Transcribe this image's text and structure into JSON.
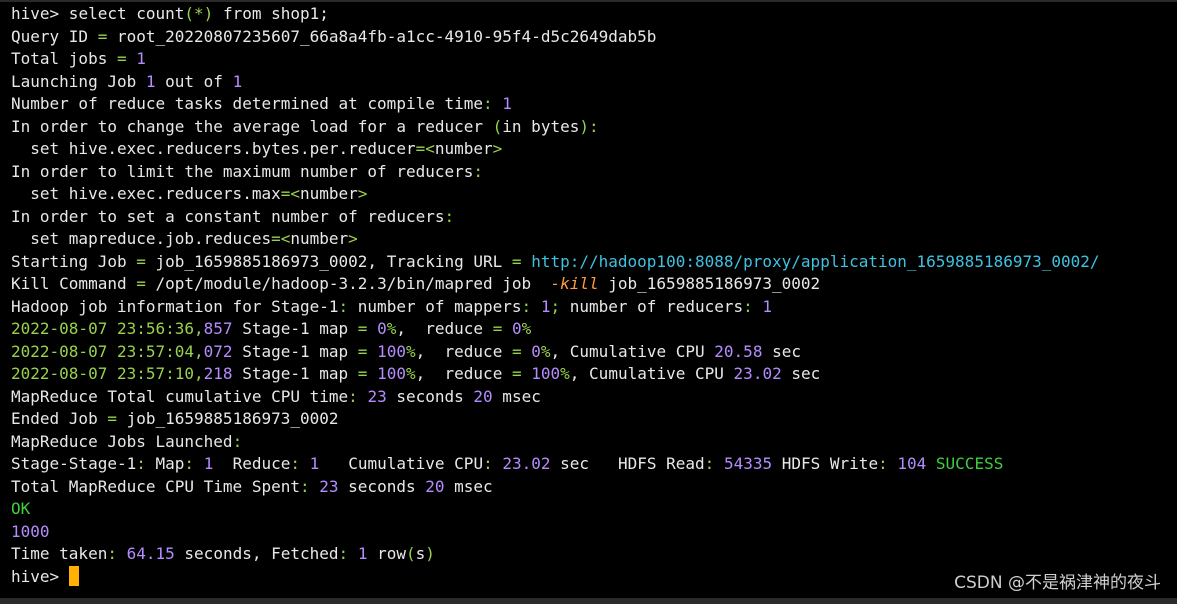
{
  "lines": {
    "l1_prompt": "hive>",
    "l1_cmd_a": " select count",
    "l1_cmd_b": "(*)",
    "l1_cmd_c": " from shop1;",
    "l2_a": "Query ID ",
    "l2_b": "=",
    "l2_c": " root_20220807235607_66a8a4fb-a1cc-4910-95f4-d5c2649dab5b",
    "l3_a": "Total jobs ",
    "l3_b": "=",
    "l3_c": "1",
    "l4_a": "Launching Job ",
    "l4_b": "1",
    "l4_c": " out of ",
    "l4_d": "1",
    "l5_a": "Number of reduce tasks determined at compile time",
    "l5_b": ":",
    "l5_c": "1",
    "l6_a": "In order to change the average load for a reducer ",
    "l6_b": "(",
    "l6_c": "in bytes",
    "l6_d": "):",
    "l7_a": "  set hive.exec.reducers.bytes.per.reducer",
    "l7_b": "=<",
    "l7_c": "number",
    "l7_d": ">",
    "l8_a": "In order to limit the maximum number of reducers",
    "l8_b": ":",
    "l9_a": "  set hive.exec.reducers.max",
    "l9_b": "=<",
    "l9_c": "number",
    "l9_d": ">",
    "l10_a": "In order to set a constant number of reducers",
    "l10_b": ":",
    "l11_a": "  set mapreduce.job.reduces",
    "l11_b": "=<",
    "l11_c": "number",
    "l11_d": ">",
    "l12_a": "Starting Job ",
    "l12_b": "=",
    "l12_c": " job_1659885186973_0002, Tracking URL ",
    "l12_d": "=",
    "l12_e": "http://hadoop100:8088/proxy/application_1659885186973_0002/",
    "l13_a": "Kill Command ",
    "l13_b": "=",
    "l13_c": " /opt/module/hadoop-3.2.3/bin/mapred job  ",
    "l13_d": "-kill",
    "l13_e": " job_1659885186973_0002",
    "l14_a": "Hadoop job information for Stage-1",
    "l14_b": ":",
    "l14_c": " number of mappers",
    "l14_d": ":",
    "l14_e": "1",
    "l14_f": ";",
    "l14_g": " number of reducers",
    "l14_h": ":",
    "l14_i": "1",
    "l15_date": "2022-08-07 23:56:36,",
    "l15_ms": "857",
    "l15_a": " Stage-1 map ",
    "l15_b": "=",
    "l15_c": "0",
    "l15_d": "%",
    "l15_e": ",  reduce ",
    "l15_f": "=",
    "l15_g": "0",
    "l15_h": "%",
    "l16_date": "2022-08-07 23:57:04,",
    "l16_ms": "072",
    "l16_a": " Stage-1 map ",
    "l16_b": "=",
    "l16_c": "100",
    "l16_d": "%",
    "l16_e": ",  reduce ",
    "l16_f": "=",
    "l16_g": "0",
    "l16_h": "%",
    "l16_i": ", Cumulative CPU ",
    "l16_j": "20.58",
    "l16_k": " sec",
    "l17_date": "2022-08-07 23:57:10,",
    "l17_ms": "218",
    "l17_a": " Stage-1 map ",
    "l17_b": "=",
    "l17_c": "100",
    "l17_d": "%",
    "l17_e": ",  reduce ",
    "l17_f": "=",
    "l17_g": "100",
    "l17_h": "%",
    "l17_i": ", Cumulative CPU ",
    "l17_j": "23.02",
    "l17_k": " sec",
    "l18_a": "MapReduce Total cumulative CPU time",
    "l18_b": ":",
    "l18_c": "23",
    "l18_d": " seconds ",
    "l18_e": "20",
    "l18_f": " msec",
    "l19_a": "Ended Job ",
    "l19_b": "=",
    "l19_c": " job_1659885186973_0002",
    "l20_a": "MapReduce Jobs Launched",
    "l20_b": ":",
    "l21_a": "Stage-Stage-1",
    "l21_b": ":",
    "l21_c": " Map",
    "l21_d": ":",
    "l21_e": "1",
    "l21_f": "  Reduce",
    "l21_g": ":",
    "l21_h": "1",
    "l21_i": "   Cumulative CPU",
    "l21_j": ":",
    "l21_k": "23.02",
    "l21_l": " sec   HDFS Read",
    "l21_m": ":",
    "l21_n": "54335",
    "l21_o": " HDFS Write",
    "l21_p": ":",
    "l21_q": "104",
    "l21_r": "SUCCESS",
    "l22_a": "Total MapReduce CPU Time Spent",
    "l22_b": ":",
    "l22_c": "23",
    "l22_d": " seconds ",
    "l22_e": "20",
    "l22_f": " msec",
    "l23": "OK",
    "l24": "1000",
    "l25_a": "Time taken",
    "l25_b": ":",
    "l25_c": "64.15",
    "l25_d": " seconds, Fetched",
    "l25_e": ":",
    "l25_f": "1",
    "l25_g": " row",
    "l25_h": "(",
    "l25_i": "s",
    "l25_j": ")",
    "l26_prompt": "hive>"
  },
  "watermark": "CSDN @不是祸津神的夜斗",
  "colors": {
    "background": "#000000",
    "text": "#e8e8e8",
    "green": "#98d24a",
    "purple": "#b58cff",
    "cyan": "#3fc1e0",
    "orange": "#ff9a3c",
    "success": "#3fcf3f",
    "cursor": "#ffb000"
  }
}
